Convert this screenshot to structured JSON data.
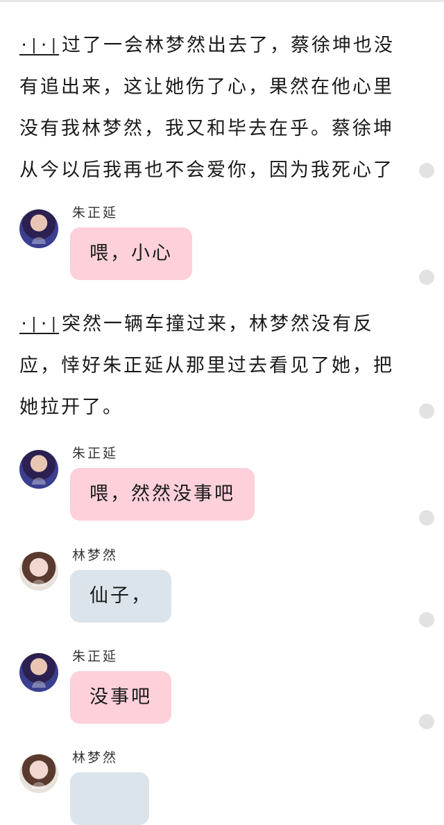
{
  "story": {
    "paragraphs": [
      {
        "marker": "·|·|",
        "text": "过了一会林梦然出去了，蔡徐坤也没有追出来，这让她伤了心，果然在他心里没有我林梦然，我又和毕去在乎。蔡徐坤从今以后我再也不会爱你，因为我死心了"
      },
      {
        "marker": "·|·|",
        "text": "突然一辆车撞过来，林梦然没有反应，悻好朱正延从那里过去看见了她，把她拉开了。"
      }
    ],
    "messages": [
      {
        "sender": "朱正延",
        "text": "喂，小心",
        "bubble_color": "#fdd0da",
        "avatar": "zhu-avatar"
      },
      {
        "sender": "朱正延",
        "text": "喂，然然没事吧",
        "bubble_color": "#fdd0da",
        "avatar": "zhu-avatar"
      },
      {
        "sender": "林梦然",
        "text": "仙子，",
        "bubble_color": "#dbe4ea",
        "avatar": "lin-avatar"
      },
      {
        "sender": "朱正延",
        "text": "没事吧",
        "bubble_color": "#fdd0da",
        "avatar": "zhu-avatar"
      },
      {
        "sender": "林梦然",
        "text": "",
        "bubble_color": "#dbe4ea",
        "avatar": "lin-avatar"
      }
    ]
  },
  "colors": {
    "pink_bubble": "#fdd0da",
    "blue_bubble": "#dbe4ea",
    "scroll_dot": "#e2e2e2"
  }
}
